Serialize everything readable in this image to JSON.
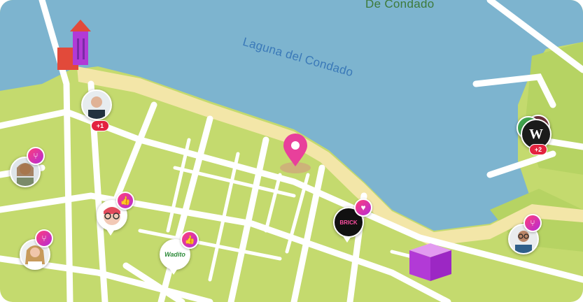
{
  "map": {
    "water_label": "Laguna del Condado",
    "district_label": "De Condado",
    "colors": {
      "land": "#c4da6e",
      "water": "#7db4cf",
      "road": "#ffffff",
      "beach": "#f3e6a8",
      "pin": "#e8409b"
    }
  },
  "markers": [
    {
      "name": "avatar-man-suit",
      "badge_icon": "",
      "count": "+1"
    },
    {
      "name": "avatar-woman-1",
      "badge_icon": "fork-knife-icon",
      "count": ""
    },
    {
      "name": "avatar-cartoon-glasses",
      "badge_icon": "thumbs-up-icon",
      "count": ""
    },
    {
      "name": "avatar-woman-2",
      "badge_icon": "fork-knife-icon",
      "count": ""
    },
    {
      "name": "logo-wadito",
      "badge_icon": "thumbs-up-icon",
      "text": "Wadito",
      "count": ""
    },
    {
      "name": "logo-brick",
      "badge_icon": "heart-icon",
      "text": "BRICK",
      "count": ""
    },
    {
      "name": "logo-w",
      "badge_icon": "",
      "text": "W",
      "count": "+2"
    },
    {
      "name": "avatar-man-glasses",
      "badge_icon": "fork-knife-icon",
      "count": ""
    }
  ]
}
